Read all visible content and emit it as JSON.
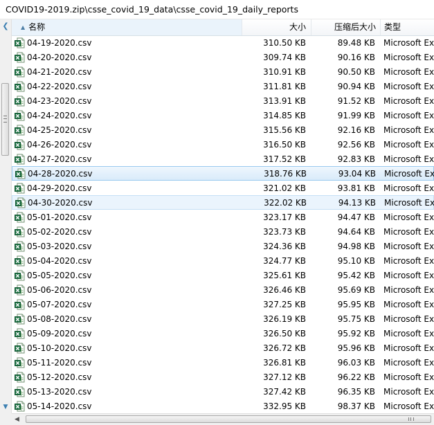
{
  "path": "COVID19-2019.zip\\csse_covid_19_data\\csse_covid_19_daily_reports",
  "columns": {
    "name": "名称",
    "size": "大小",
    "compressed": "压缩后大小",
    "type": "类型"
  },
  "files": [
    {
      "name": "04-19-2020.csv",
      "size": "310.50 KB",
      "compressed": "89.48 KB",
      "type": "Microsoft Ex"
    },
    {
      "name": "04-20-2020.csv",
      "size": "309.74 KB",
      "compressed": "90.16 KB",
      "type": "Microsoft Ex"
    },
    {
      "name": "04-21-2020.csv",
      "size": "310.91 KB",
      "compressed": "90.50 KB",
      "type": "Microsoft Ex"
    },
    {
      "name": "04-22-2020.csv",
      "size": "311.81 KB",
      "compressed": "90.94 KB",
      "type": "Microsoft Ex"
    },
    {
      "name": "04-23-2020.csv",
      "size": "313.91 KB",
      "compressed": "91.52 KB",
      "type": "Microsoft Ex"
    },
    {
      "name": "04-24-2020.csv",
      "size": "314.85 KB",
      "compressed": "91.99 KB",
      "type": "Microsoft Ex"
    },
    {
      "name": "04-25-2020.csv",
      "size": "315.56 KB",
      "compressed": "92.16 KB",
      "type": "Microsoft Ex"
    },
    {
      "name": "04-26-2020.csv",
      "size": "316.50 KB",
      "compressed": "92.56 KB",
      "type": "Microsoft Ex"
    },
    {
      "name": "04-27-2020.csv",
      "size": "317.52 KB",
      "compressed": "92.83 KB",
      "type": "Microsoft Ex"
    },
    {
      "name": "04-28-2020.csv",
      "size": "318.76 KB",
      "compressed": "93.04 KB",
      "type": "Microsoft Ex"
    },
    {
      "name": "04-29-2020.csv",
      "size": "321.02 KB",
      "compressed": "93.81 KB",
      "type": "Microsoft Ex"
    },
    {
      "name": "04-30-2020.csv",
      "size": "322.02 KB",
      "compressed": "94.13 KB",
      "type": "Microsoft Ex"
    },
    {
      "name": "05-01-2020.csv",
      "size": "323.17 KB",
      "compressed": "94.47 KB",
      "type": "Microsoft Ex"
    },
    {
      "name": "05-02-2020.csv",
      "size": "323.73 KB",
      "compressed": "94.64 KB",
      "type": "Microsoft Ex"
    },
    {
      "name": "05-03-2020.csv",
      "size": "324.36 KB",
      "compressed": "94.98 KB",
      "type": "Microsoft Ex"
    },
    {
      "name": "05-04-2020.csv",
      "size": "324.77 KB",
      "compressed": "95.10 KB",
      "type": "Microsoft Ex"
    },
    {
      "name": "05-05-2020.csv",
      "size": "325.61 KB",
      "compressed": "95.42 KB",
      "type": "Microsoft Ex"
    },
    {
      "name": "05-06-2020.csv",
      "size": "326.46 KB",
      "compressed": "95.69 KB",
      "type": "Microsoft Ex"
    },
    {
      "name": "05-07-2020.csv",
      "size": "327.25 KB",
      "compressed": "95.95 KB",
      "type": "Microsoft Ex"
    },
    {
      "name": "05-08-2020.csv",
      "size": "326.19 KB",
      "compressed": "95.75 KB",
      "type": "Microsoft Ex"
    },
    {
      "name": "05-09-2020.csv",
      "size": "326.50 KB",
      "compressed": "95.92 KB",
      "type": "Microsoft Ex"
    },
    {
      "name": "05-10-2020.csv",
      "size": "326.72 KB",
      "compressed": "95.96 KB",
      "type": "Microsoft Ex"
    },
    {
      "name": "05-11-2020.csv",
      "size": "326.81 KB",
      "compressed": "96.03 KB",
      "type": "Microsoft Ex"
    },
    {
      "name": "05-12-2020.csv",
      "size": "327.12 KB",
      "compressed": "96.22 KB",
      "type": "Microsoft Ex"
    },
    {
      "name": "05-13-2020.csv",
      "size": "327.42 KB",
      "compressed": "96.35 KB",
      "type": "Microsoft Ex"
    },
    {
      "name": "05-14-2020.csv",
      "size": "332.95 KB",
      "compressed": "98.37 KB",
      "type": "Microsoft Ex"
    }
  ],
  "selected_file": "04-28-2020.csv",
  "focused_file": "04-30-2020.csv",
  "icons": {
    "file": "excel-csv-icon",
    "sort": "sort-up-icon"
  },
  "colors": {
    "selection_border": "#99c9ef",
    "selection_fill": "#d9ebfa",
    "icon_green": "#1e7145"
  }
}
